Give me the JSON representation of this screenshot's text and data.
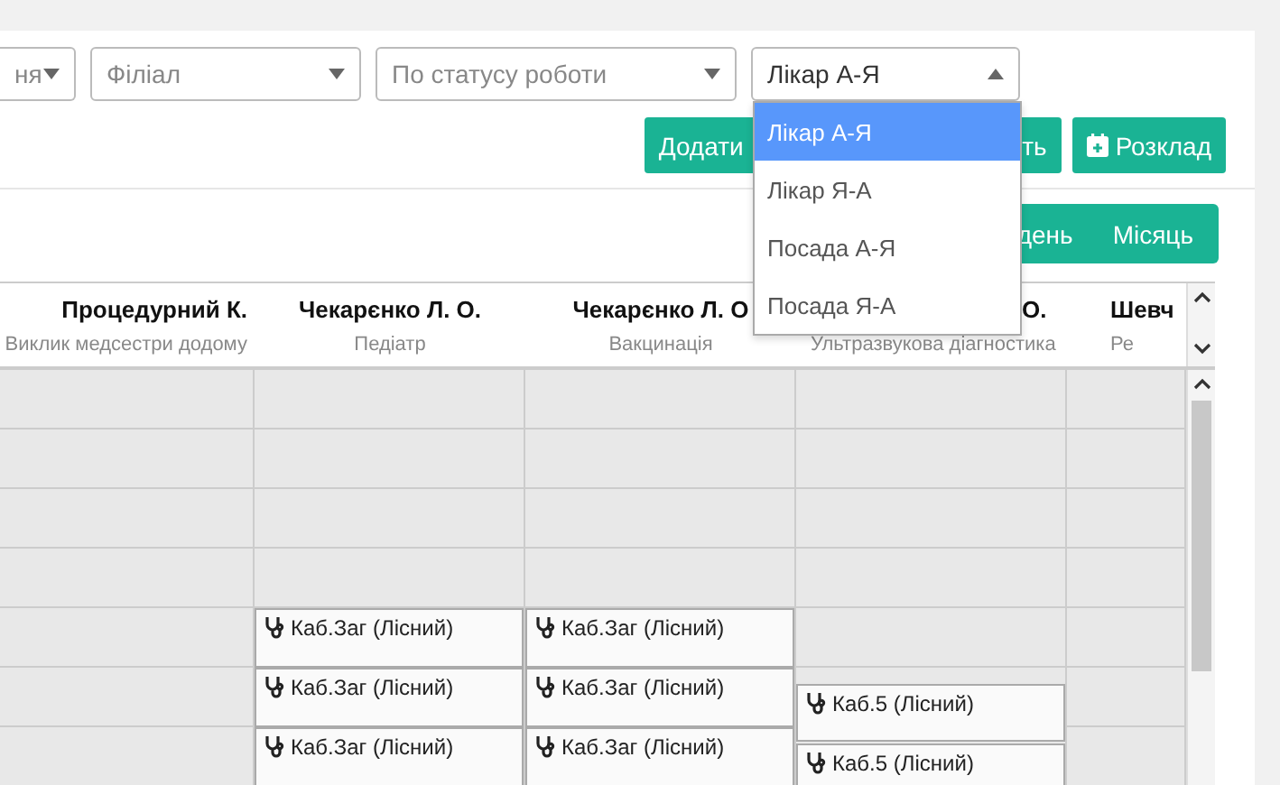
{
  "filters": [
    {
      "kind": "placeholder",
      "text": "ня"
    },
    {
      "kind": "placeholder",
      "text": "Філіал"
    },
    {
      "kind": "placeholder",
      "text": "По статусу роботи"
    }
  ],
  "sort": {
    "value": "Лікар А-Я",
    "expanded": true,
    "options": [
      {
        "label": "Лікар А-Я",
        "selected": true
      },
      {
        "label": "Лікар Я-А",
        "selected": false
      },
      {
        "label": "Посада А-Я",
        "selected": false
      },
      {
        "label": "Посада Я-А",
        "selected": false
      }
    ]
  },
  "actions": [
    {
      "label": "Додати",
      "icon": false
    },
    {
      "label": "ть",
      "icon": false
    },
    {
      "label": "Розклад",
      "icon": true
    }
  ],
  "views": [
    "день",
    "Місяць"
  ],
  "columns": [
    {
      "name": "Процедурний К.",
      "role": "Виклик медсестри додому"
    },
    {
      "name": "Чекарєнко Л. О.",
      "role": "Педіатр"
    },
    {
      "name": "Чекарєнко Л. О",
      "role": "Вакцинація"
    },
    {
      "name": "О.",
      "role": "Ультразвукова діагностика"
    },
    {
      "name": "Шевч",
      "role": "Ре"
    }
  ],
  "rows": [
    [
      {
        "kind": "empty"
      },
      {
        "kind": "empty"
      },
      {
        "kind": "empty"
      },
      {
        "kind": "empty"
      },
      {
        "kind": "empty"
      }
    ],
    [
      {
        "kind": "empty"
      },
      {
        "kind": "empty"
      },
      {
        "kind": "empty"
      },
      {
        "kind": "empty"
      },
      {
        "kind": "empty"
      }
    ],
    [
      {
        "kind": "empty"
      },
      {
        "kind": "empty"
      },
      {
        "kind": "empty"
      },
      {
        "kind": "empty"
      },
      {
        "kind": "empty"
      }
    ],
    [
      {
        "kind": "empty"
      },
      {
        "kind": "empty"
      },
      {
        "kind": "empty"
      },
      {
        "kind": "empty"
      },
      {
        "kind": "empty"
      }
    ],
    [
      {
        "kind": "empty"
      },
      {
        "kind": "appointment",
        "text": "Каб.Заг (Лісний)",
        "shifted": false
      },
      {
        "kind": "appointment",
        "text": "Каб.Заг (Лісний)",
        "shifted": false
      },
      {
        "kind": "empty"
      },
      {
        "kind": "empty"
      }
    ],
    [
      {
        "kind": "empty"
      },
      {
        "kind": "appointment",
        "text": "Каб.Заг (Лісний)",
        "shifted": false
      },
      {
        "kind": "appointment",
        "text": "Каб.Заг (Лісний)",
        "shifted": false
      },
      {
        "kind": "appointment",
        "text": "Каб.5 (Лісний)",
        "shifted": true
      },
      {
        "kind": "empty"
      }
    ],
    [
      {
        "kind": "empty"
      },
      {
        "kind": "appointment",
        "text": "Каб.Заг (Лісний)",
        "shifted": false
      },
      {
        "kind": "appointment",
        "text": "Каб.Заг (Лісний)",
        "shifted": false
      },
      {
        "kind": "appointment",
        "text": "Каб.5 (Лісний)",
        "shifted": true
      },
      {
        "kind": "empty"
      }
    ]
  ]
}
